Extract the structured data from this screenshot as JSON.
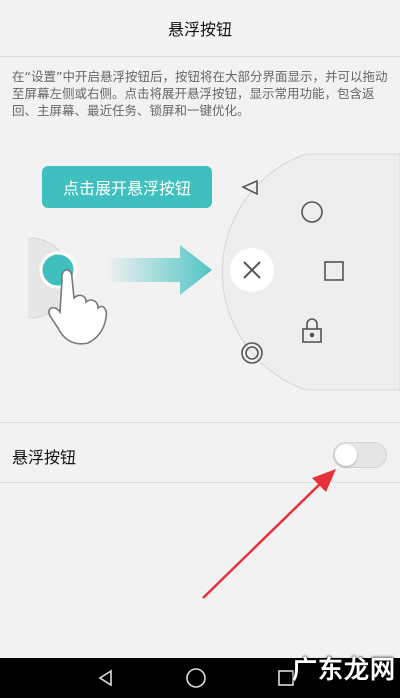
{
  "header": {
    "title": "悬浮按钮"
  },
  "description": "在“设置”中开启悬浮按钮后，按钮将在大部分界面显示，并可以拖动至屏幕左侧或右侧。点击将展开悬浮按钮，显示常用功能，包含返回、主屏幕、最近任务、锁屏和一键优化。",
  "illustration": {
    "hint_label": "点击展开悬浮按钮",
    "menu_icons": [
      "back-triangle-icon",
      "home-circle-icon",
      "recent-square-icon",
      "lock-icon",
      "optimize-icon",
      "close-icon"
    ],
    "accent_color": "#40bfbf"
  },
  "setting": {
    "label": "悬浮按钮",
    "toggle_on": false
  },
  "navbar": {
    "buttons": [
      "back-icon",
      "home-icon",
      "recent-icon"
    ]
  },
  "watermark": "广东龙网",
  "colors": {
    "arrow": "#e8303a",
    "teal": "#40bfbf"
  }
}
